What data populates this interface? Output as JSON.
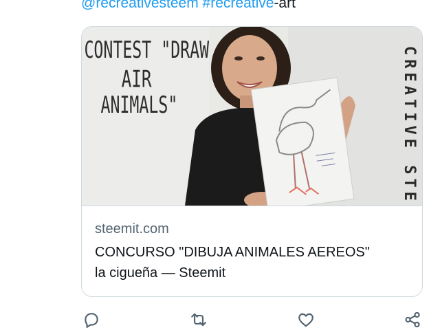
{
  "tweet": {
    "text_link": "@recreativesteem #recreative",
    "text_rest": "-art"
  },
  "card": {
    "image": {
      "board_line1": "CONTEST \"DRAW",
      "board_line2": "AIR",
      "board_line3": "ANIMALS\"",
      "vertical_text": "CREATIVE STEE"
    },
    "domain": "steemit.com",
    "title": "CONCURSO \"DIBUJA ANIMALES AEREOS\"",
    "subtitle": "la cigueña — Steemit"
  },
  "actions": {
    "icons": [
      "reply-icon",
      "retweet-icon",
      "like-icon",
      "share-icon"
    ],
    "icon_color": "#536471"
  },
  "colors": {
    "link": "#1d9bf0",
    "border": "#cfd9de",
    "secondary_text": "#536471"
  }
}
